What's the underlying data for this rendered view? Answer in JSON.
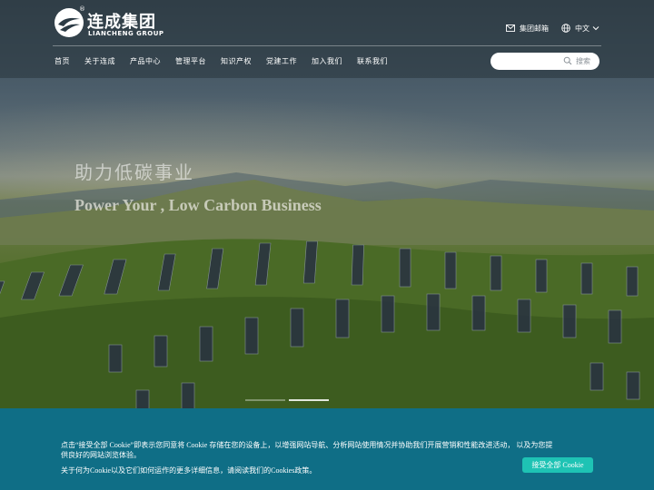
{
  "brand": {
    "name_cn": "连成集团",
    "name_en": "LIANCHENG GROUP",
    "registered_mark": "®"
  },
  "top_links": {
    "mail_label": "集团邮箱",
    "mail_icon": "mail-icon",
    "language_label": "中文",
    "language_icon": "globe-icon"
  },
  "nav": {
    "items": [
      {
        "label": "首页"
      },
      {
        "label": "关于连成"
      },
      {
        "label": "产品中心"
      },
      {
        "label": "管理平台"
      },
      {
        "label": "知识产权"
      },
      {
        "label": "党建工作"
      },
      {
        "label": "加入我们"
      },
      {
        "label": "联系我们"
      }
    ]
  },
  "search": {
    "placeholder": "搜索",
    "icon": "search-icon"
  },
  "hero": {
    "title_cn": "助力低碳事业",
    "title_en": "Power Your , Low Carbon Business",
    "slides": 2,
    "active_slide": 1
  },
  "cookie": {
    "text_main": "点击“接受全部 Cookie”即表示您同意将 Cookie 存储在您的设备上，以增强网站导航、分析网站使用情况并协助我们开展营销和性能改进活动， 以及为您提供良好的网站浏览体验。",
    "text_more": "关于何为Cookie以及它们如何运作的更多详细信息，请阅读我们的Cookies政策。",
    "accept_label": "接受全部 Cookie"
  },
  "colors": {
    "cookie_bg": "#0f6e86",
    "accept_button": "#1ec3b4"
  }
}
